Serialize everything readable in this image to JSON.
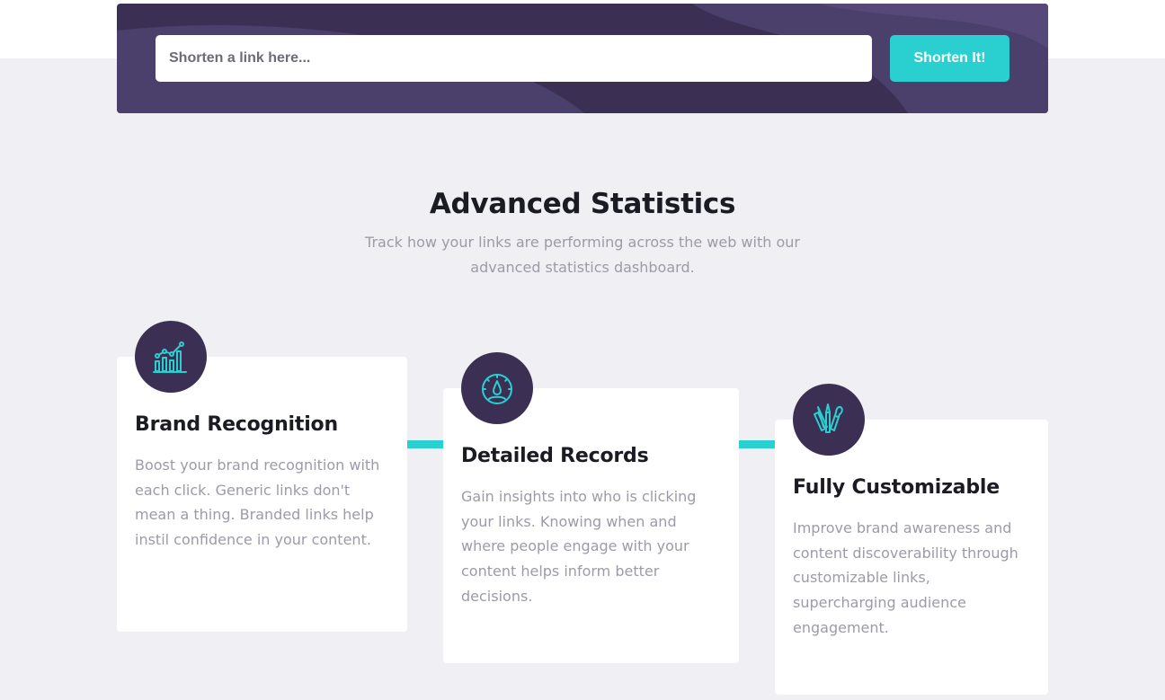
{
  "shorten": {
    "placeholder": "Shorten a link here...",
    "button_label": "Shorten It!"
  },
  "statistics": {
    "title": "Advanced Statistics",
    "subtitle": "Track how your links are performing across the web with our advanced statistics dashboard."
  },
  "cards": [
    {
      "icon": "bar-chart-icon",
      "title": "Brand Recognition",
      "text": "Boost your brand recognition with each click. Generic links don't mean a thing. Branded links help instil confidence in your content."
    },
    {
      "icon": "speedometer-icon",
      "title": "Detailed Records",
      "text": "Gain insights into who is clicking your links. Knowing when and where people engage with your content helps inform better decisions."
    },
    {
      "icon": "design-tools-icon",
      "title": "Fully Customizable",
      "text": "Improve brand awareness and content discoverability through customizable links, supercharging audience engagement."
    }
  ],
  "colors": {
    "primary_cyan": "#2acfcf",
    "dark_violet": "#3b3054",
    "background": "#efeff4",
    "heading": "#1b1b24",
    "body_text": "#9e9aa7"
  }
}
